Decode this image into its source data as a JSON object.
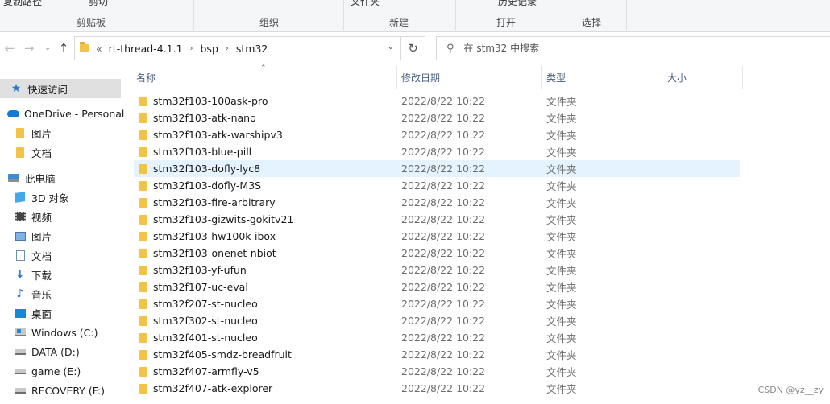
{
  "ribbon": {
    "groups": [
      {
        "label": "剪贴板",
        "top_items": [
          "复制路径",
          "剪切"
        ]
      },
      {
        "label": "组织"
      },
      {
        "label": "新建",
        "top_items": [
          "文件夹"
        ]
      },
      {
        "label": "打开",
        "top_items": [
          "历史记录"
        ]
      },
      {
        "label": "选择"
      }
    ]
  },
  "nav": {
    "back_icon": "back-arrow-icon",
    "forward_icon": "forward-arrow-icon",
    "recent_icon": "chevron-down-icon",
    "up_icon": "up-arrow-icon"
  },
  "address": {
    "overflow": "«",
    "crumbs": [
      "rt-thread-4.1.1",
      "bsp",
      "stm32"
    ],
    "separator": "›"
  },
  "search": {
    "placeholder": "在 stm32 中搜索"
  },
  "sidebar": {
    "items": [
      {
        "label": "快速访问",
        "icon": "star-icon"
      },
      {
        "label": "OneDrive - Personal",
        "icon": "cloud-icon"
      },
      {
        "label": "图片",
        "icon": "folder-icon"
      },
      {
        "label": "文档",
        "icon": "folder-icon"
      },
      {
        "label": "此电脑",
        "icon": "computer-icon"
      },
      {
        "label": "3D 对象",
        "icon": "cube-icon"
      },
      {
        "label": "视频",
        "icon": "video-icon"
      },
      {
        "label": "图片",
        "icon": "picture-icon"
      },
      {
        "label": "文档",
        "icon": "document-icon"
      },
      {
        "label": "下载",
        "icon": "download-icon"
      },
      {
        "label": "音乐",
        "icon": "music-icon"
      },
      {
        "label": "桌面",
        "icon": "desktop-icon"
      },
      {
        "label": "Windows (C:)",
        "icon": "windows-drive-icon"
      },
      {
        "label": "DATA (D:)",
        "icon": "drive-icon"
      },
      {
        "label": "game (E:)",
        "icon": "drive-icon"
      },
      {
        "label": "RECOVERY (F:)",
        "icon": "drive-icon"
      }
    ]
  },
  "columns": {
    "name": "名称",
    "date": "修改日期",
    "type": "类型",
    "size": "大小"
  },
  "files": [
    {
      "name": "stm32f103-100ask-pro",
      "date": "2022/8/22 10:22",
      "type": "文件夹"
    },
    {
      "name": "stm32f103-atk-nano",
      "date": "2022/8/22 10:22",
      "type": "文件夹"
    },
    {
      "name": "stm32f103-atk-warshipv3",
      "date": "2022/8/22 10:22",
      "type": "文件夹"
    },
    {
      "name": "stm32f103-blue-pill",
      "date": "2022/8/22 10:22",
      "type": "文件夹"
    },
    {
      "name": "stm32f103-dofly-lyc8",
      "date": "2022/8/22 10:22",
      "type": "文件夹"
    },
    {
      "name": "stm32f103-dofly-M3S",
      "date": "2022/8/22 10:22",
      "type": "文件夹"
    },
    {
      "name": "stm32f103-fire-arbitrary",
      "date": "2022/8/22 10:22",
      "type": "文件夹"
    },
    {
      "name": "stm32f103-gizwits-gokitv21",
      "date": "2022/8/22 10:22",
      "type": "文件夹"
    },
    {
      "name": "stm32f103-hw100k-ibox",
      "date": "2022/8/22 10:22",
      "type": "文件夹"
    },
    {
      "name": "stm32f103-onenet-nbiot",
      "date": "2022/8/22 10:22",
      "type": "文件夹"
    },
    {
      "name": "stm32f103-yf-ufun",
      "date": "2022/8/22 10:22",
      "type": "文件夹"
    },
    {
      "name": "stm32f107-uc-eval",
      "date": "2022/8/22 10:22",
      "type": "文件夹"
    },
    {
      "name": "stm32f207-st-nucleo",
      "date": "2022/8/22 10:22",
      "type": "文件夹"
    },
    {
      "name": "stm32f302-st-nucleo",
      "date": "2022/8/22 10:22",
      "type": "文件夹"
    },
    {
      "name": "stm32f401-st-nucleo",
      "date": "2022/8/22 10:22",
      "type": "文件夹"
    },
    {
      "name": "stm32f405-smdz-breadfruit",
      "date": "2022/8/22 10:22",
      "type": "文件夹"
    },
    {
      "name": "stm32f407-armfly-v5",
      "date": "2022/8/22 10:22",
      "type": "文件夹"
    },
    {
      "name": "stm32f407-atk-explorer",
      "date": "2022/8/22 10:22",
      "type": "文件夹"
    }
  ],
  "watermark": "CSDN @yz__zy"
}
